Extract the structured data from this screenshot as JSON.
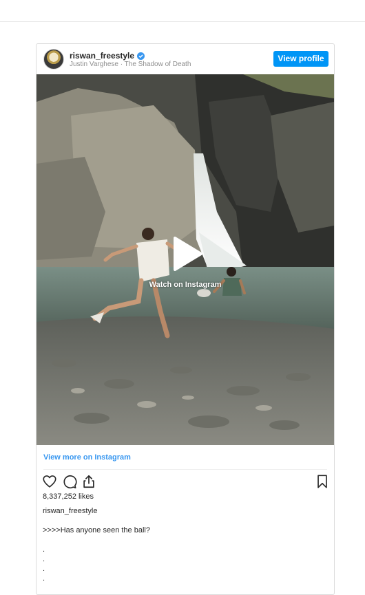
{
  "post": {
    "username": "riswan_freestyle",
    "subtitle": "Justin Varghese · The Shadow of Death",
    "view_profile_label": "View profile",
    "watch_label": "Watch on Instagram",
    "view_more_label": "View more on Instagram",
    "likes": "8,337,252 likes",
    "caption_user": "riswan_freestyle",
    "caption_text": ">>>>Has anyone seen the ball?",
    "dots": [
      ".",
      ".",
      ".",
      "."
    ]
  },
  "icons": {
    "verified": "verified-badge-icon",
    "like": "heart-icon",
    "comment": "comment-icon",
    "share": "share-icon",
    "save": "bookmark-icon",
    "play": "play-icon"
  },
  "colors": {
    "accent": "#0095f6",
    "link": "#3897f0",
    "text": "#262626",
    "muted": "#8e8e8e"
  }
}
